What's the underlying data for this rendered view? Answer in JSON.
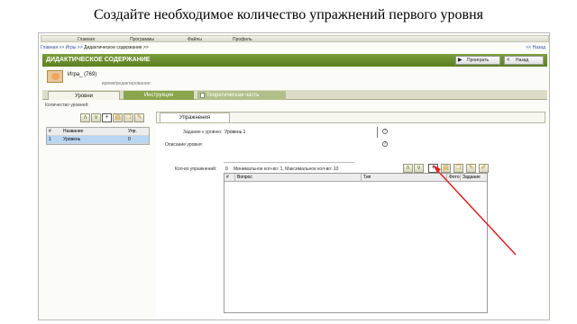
{
  "slide": {
    "title": "Создайте необходимое количество упражнений первого уровня"
  },
  "menu": {
    "items": [
      "Главная",
      "Программы",
      "Файлы",
      "Профиль"
    ]
  },
  "breadcrumbs": {
    "parts": [
      "Главная >>",
      "Игры >>",
      "Дидактическое содержание >>"
    ],
    "back": "<< Назад"
  },
  "header": {
    "title": "ДИДАКТИЧЕСКОЕ СОДЕРЖАНИЕ",
    "play_label": "Проиграть",
    "back_label": "Назад"
  },
  "game": {
    "name": "Игра_ (769)",
    "subtitle": "время/редактирование:"
  },
  "tabs": [
    "Уровни",
    "Инструкция",
    "Теоретическая часть"
  ],
  "levels_panel": {
    "label": "Количество уровней:",
    "columns": [
      "#",
      "Название",
      "Упр."
    ],
    "rows": [
      {
        "num": "1",
        "name": "Уровень",
        "count": "0"
      }
    ]
  },
  "exercises_panel": {
    "tab_label": "Упражнения",
    "fields": [
      {
        "label": "Задание к уровню:",
        "value": "Уровень 1"
      },
      {
        "label": "Описание уровня:",
        "value": ""
      }
    ],
    "count_label": "Кол-во упражнений:",
    "count_value": "0",
    "count_note": "Минимальное кол-во: 1, Максимальное кол-во: 10",
    "columns": [
      "#",
      "Вопрос",
      "Тип",
      "Фото",
      "Задание"
    ]
  },
  "icons": {
    "up": "arrow-up-icon",
    "down": "arrow-down-icon",
    "add": "add-icon",
    "edit": "edit-icon",
    "copy": "copy-icon",
    "delete": "delete-icon"
  },
  "colors": {
    "header_green": "#6a8e2c",
    "annotation_red": "#e02020"
  }
}
